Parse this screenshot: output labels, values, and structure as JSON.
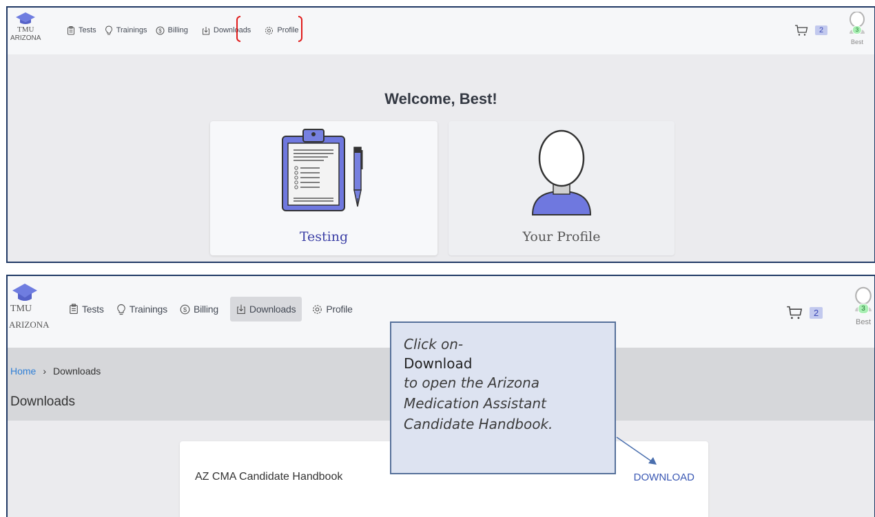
{
  "brand": {
    "name": "TMU",
    "sub": "ARIZONA"
  },
  "nav": {
    "tests": "Tests",
    "trainings": "Trainings",
    "billing": "Billing",
    "downloads": "Downloads",
    "profile": "Profile"
  },
  "cart_count": "2",
  "user": {
    "name": "Best",
    "badge": "3"
  },
  "dashboard": {
    "welcome": "Welcome, Best!",
    "card_testing": "Testing",
    "card_profile": "Your Profile"
  },
  "downloads_page": {
    "breadcrumb_home": "Home",
    "breadcrumb_sep": "›",
    "breadcrumb_current": "Downloads",
    "title": "Downloads",
    "item_name": "AZ CMA Candidate Handbook",
    "item_action": "DOWNLOAD"
  },
  "callout": {
    "line1": "Click on-",
    "line2": "Download",
    "line3": "to open the Arizona",
    "line4": "Medication Assistant",
    "line5": "Candidate Handbook."
  },
  "colors": {
    "accent": "#3c40a6",
    "link": "#2f7fd6",
    "highlight_bracket": "#e01b1b",
    "callout_fill": "#dde3f1"
  }
}
